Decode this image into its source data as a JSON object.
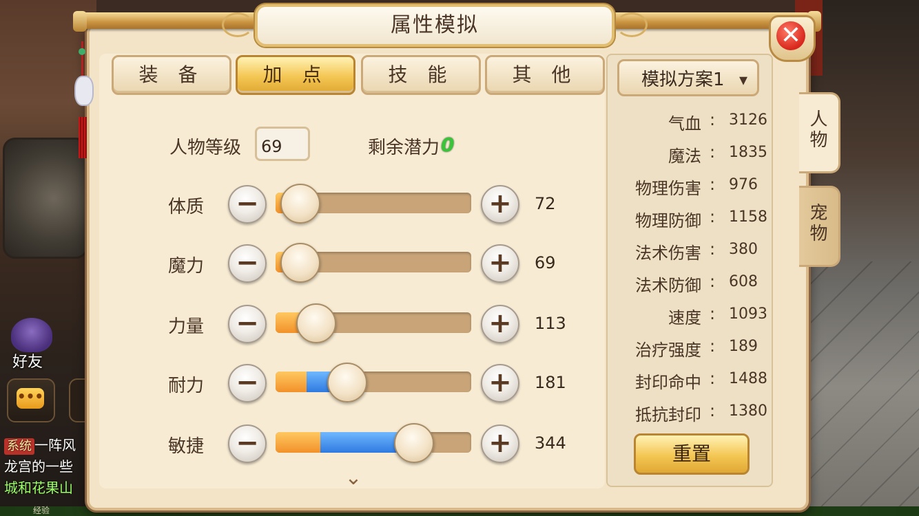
{
  "window": {
    "title": "属性模拟"
  },
  "tabs": [
    {
      "label": "装 备",
      "active": false
    },
    {
      "label": "加 点",
      "active": true
    },
    {
      "label": "技 能",
      "active": false
    },
    {
      "label": "其 他",
      "active": false
    }
  ],
  "level": {
    "label": "人物等级",
    "value": "69"
  },
  "potential": {
    "label": "剩余潜力",
    "value": "0"
  },
  "stats": [
    {
      "name": "体质",
      "value": "72",
      "base_fraction": 0.12,
      "extra_fraction": 0.0,
      "knob_fraction": 0.12
    },
    {
      "name": "魔力",
      "value": "69",
      "base_fraction": 0.12,
      "extra_fraction": 0.0,
      "knob_fraction": 0.12
    },
    {
      "name": "力量",
      "value": "113",
      "base_fraction": 0.17,
      "extra_fraction": 0.0,
      "knob_fraction": 0.2
    },
    {
      "name": "耐力",
      "value": "181",
      "base_fraction": 0.16,
      "extra_fraction": 0.18,
      "knob_fraction": 0.36
    },
    {
      "name": "敏捷",
      "value": "344",
      "base_fraction": 0.23,
      "extra_fraction": 0.47,
      "knob_fraction": 0.7
    }
  ],
  "scheme": {
    "label": "模拟方案1"
  },
  "attributes": [
    {
      "name": "气血",
      "value": "3126"
    },
    {
      "name": "魔法",
      "value": "1835"
    },
    {
      "name": "物理伤害",
      "value": "976"
    },
    {
      "name": "物理防御",
      "value": "1158"
    },
    {
      "name": "法术伤害",
      "value": "380"
    },
    {
      "name": "法术防御",
      "value": "608"
    },
    {
      "name": "速度",
      "value": "1093"
    },
    {
      "name": "治疗强度",
      "value": "189"
    },
    {
      "name": "封印命中",
      "value": "1488"
    },
    {
      "name": "抵抗封印",
      "value": "1380"
    }
  ],
  "reset_label": "重置",
  "side_tabs": [
    {
      "label": "人\n物",
      "active": true
    },
    {
      "label": "宠\n物",
      "active": false
    }
  ],
  "hud": {
    "friend_label": "好友",
    "chat_system_tag": "系统",
    "chat_line1": "一阵风",
    "chat_line2": "龙宫的一些",
    "chat_line3": "城和花果山",
    "exp_label": "经验"
  },
  "colors": {
    "gold_button": "#f4c653",
    "potential_green": "#3ac43a",
    "bar_orange": "#f2912a",
    "bar_blue": "#2f7ae0",
    "close_red": "#d8271c"
  }
}
